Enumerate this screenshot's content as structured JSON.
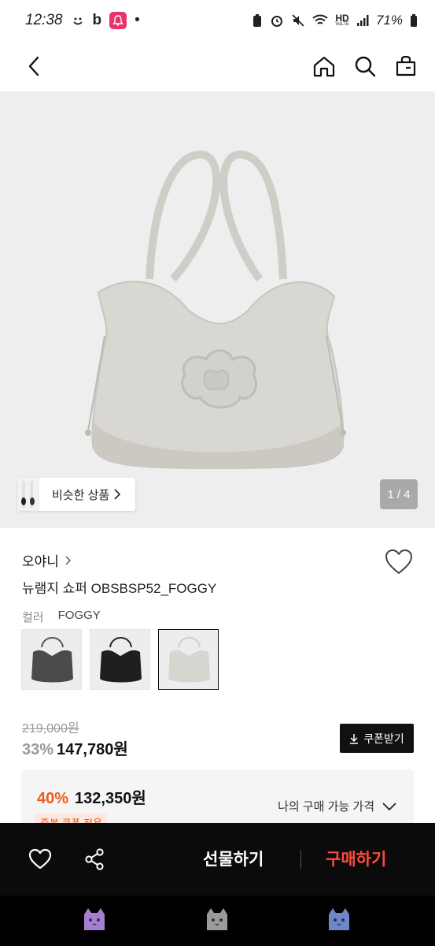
{
  "status_bar": {
    "time": "12:38",
    "app_text": "b",
    "network": "HD",
    "network_sub": "VoLTE",
    "battery": "71%"
  },
  "hero": {
    "similar_label": "비슷한 상품",
    "page_indicator": "1 / 4"
  },
  "product": {
    "brand": "오야니",
    "name": "뉴램지 쇼퍼 OBSBSP52_FOGGY",
    "color_label": "컬러",
    "color_value": "FOGGY",
    "swatches": [
      "charcoal",
      "black",
      "foggy"
    ]
  },
  "pricing": {
    "original_price": "219,000원",
    "discount_rate": "33%",
    "sale_price": "147,780원",
    "coupon_button": "쿠폰받기",
    "best_discount": "40%",
    "best_price": "132,350원",
    "my_price_label": "나의 구매 가능 가격",
    "dup_coupon": "중복 쿠폰 적용"
  },
  "bottom_bar": {
    "gift_label": "선물하기",
    "buy_label": "구매하기"
  },
  "colors": {
    "accent_orange": "#ee5a1f",
    "buy_red": "#ff4b3a",
    "bar_black": "#0b0b0b"
  }
}
